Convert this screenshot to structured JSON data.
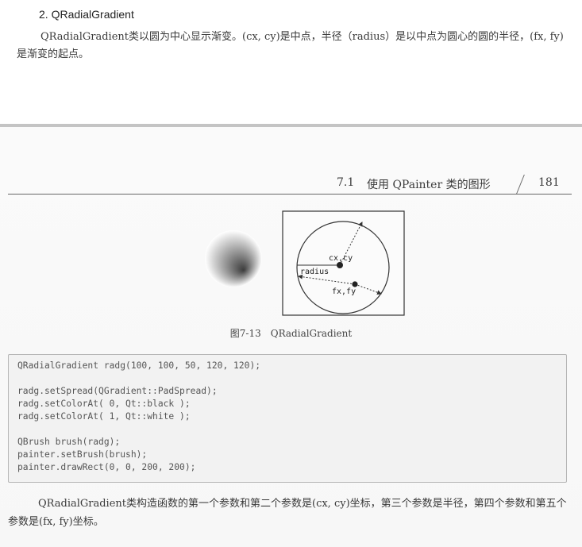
{
  "section": {
    "heading": "2. QRadialGradient",
    "paragraph": "QRadialGradient类以圆为中心显示渐变。(cx, cy)是中点，半径（radius）是以中点为圆心的圆的半径，(fx, fy)是渐变的起点。"
  },
  "running_head": {
    "section_number": "7.1",
    "title": "使用 QPainter 类的图形",
    "page_number": "181"
  },
  "figure": {
    "caption": "图7-13　QRadialGradient",
    "labels": {
      "center": "cx,cy",
      "radius": "radius",
      "focal": "fx,fy"
    },
    "gradient_colors": [
      "#3c3c3c",
      "#ffffff"
    ]
  },
  "code": {
    "lines": [
      "QRadialGradient radg(100, 100, 50, 120, 120);",
      "",
      "radg.setSpread(QGradient::PadSpread);",
      "radg.setColorAt( 0, Qt::black );",
      "radg.setColorAt( 1, Qt::white );",
      "",
      "QBrush brush(radg);",
      "painter.setBrush(brush);",
      "painter.drawRect(0, 0, 200, 200);"
    ]
  },
  "body": {
    "paragraph": "QRadialGradient类构造函数的第一个参数和第二个参数是(cx, cy)坐标，第三个参数是半径，第四个参数和第五个参数是(fx, fy)坐标。"
  }
}
